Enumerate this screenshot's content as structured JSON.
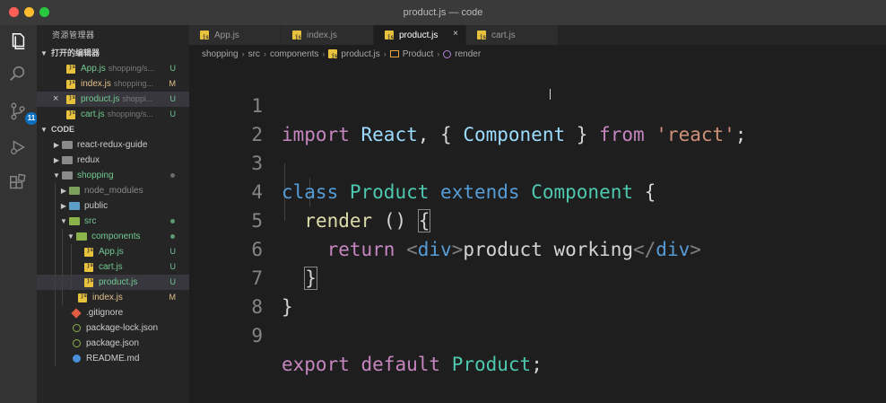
{
  "window": {
    "title": "product.js — code"
  },
  "sidebar": {
    "title": "资源管理器",
    "open_editors": {
      "label": "打开的编辑器",
      "items": [
        {
          "name": "App.js",
          "path": "shopping/s...",
          "status": "U"
        },
        {
          "name": "index.js",
          "path": "shopping...",
          "status": "M"
        },
        {
          "name": "product.js",
          "path": "shoppi...",
          "status": "U"
        },
        {
          "name": "cart.js",
          "path": "shopping/s...",
          "status": "U"
        }
      ]
    },
    "workspace": {
      "label": "CODE",
      "items": [
        {
          "name": "react-redux-guide"
        },
        {
          "name": "redux"
        },
        {
          "name": "shopping"
        },
        {
          "name": "node_modules"
        },
        {
          "name": "public"
        },
        {
          "name": "src"
        },
        {
          "name": "components"
        },
        {
          "name": "App.js",
          "status": "U"
        },
        {
          "name": "cart.js",
          "status": "U"
        },
        {
          "name": "product.js",
          "status": "U"
        },
        {
          "name": "index.js",
          "status": "M"
        },
        {
          "name": ".gitignore"
        },
        {
          "name": "package-lock.json"
        },
        {
          "name": "package.json"
        },
        {
          "name": "README.md"
        }
      ]
    }
  },
  "activity_bar": {
    "source_control_badge": "11"
  },
  "tabs": [
    {
      "label": "App.js"
    },
    {
      "label": "index.js"
    },
    {
      "label": "product.js"
    },
    {
      "label": "cart.js"
    }
  ],
  "tab_close_glyph": "×",
  "breadcrumb": [
    "shopping",
    "src",
    "components",
    "product.js",
    "Product",
    "render"
  ],
  "breadcrumb_sep": "›",
  "editor": {
    "line_numbers": [
      "1",
      "2",
      "3",
      "4",
      "5",
      "6",
      "7",
      "8",
      "9"
    ],
    "l1": [
      "import",
      "React",
      ", { ",
      "Component",
      " } ",
      "from",
      "'react'",
      ";"
    ],
    "l3": [
      "class",
      "Product",
      "extends",
      "Component",
      "{"
    ],
    "l4": [
      "render",
      "()",
      "{"
    ],
    "l5": [
      "return",
      "<",
      "div",
      ">",
      "product working",
      "</",
      "div",
      ">"
    ],
    "l6": [
      "}"
    ],
    "l7": [
      "}"
    ],
    "l9": [
      "export",
      "default",
      "Product",
      ";"
    ]
  },
  "colors": {
    "keyword": "#c586c0",
    "type": "#4ec9b0",
    "string": "#ce9178",
    "function": "#dcdcaa",
    "untracked": "#73c991",
    "modified": "#e2c08d"
  }
}
